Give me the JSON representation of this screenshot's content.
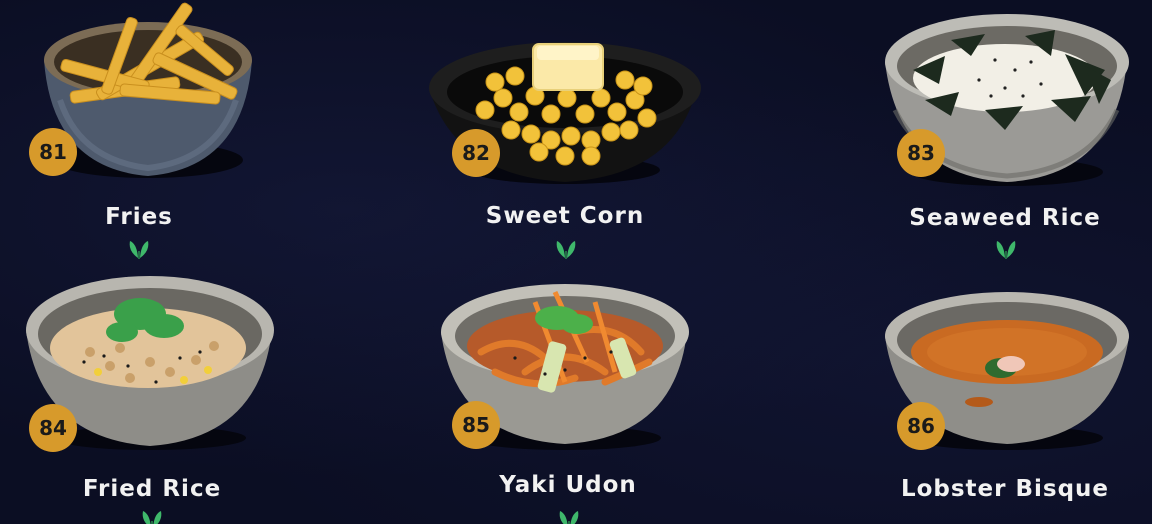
{
  "menu": {
    "items": [
      {
        "number": "81",
        "name": "Fries",
        "vegetarian_icon": "leaf-icon"
      },
      {
        "number": "82",
        "name": "Sweet Corn",
        "vegetarian_icon": "leaf-icon"
      },
      {
        "number": "83",
        "name": "Seaweed Rice",
        "vegetarian_icon": "leaf-icon"
      },
      {
        "number": "84",
        "name": "Fried Rice",
        "vegetarian_icon": "leaf-icon"
      },
      {
        "number": "85",
        "name": "Yaki Udon",
        "vegetarian_icon": "leaf-icon"
      },
      {
        "number": "86",
        "name": "Lobster Bisque",
        "vegetarian_icon": "leaf-icon"
      }
    ]
  },
  "colors": {
    "background": "#0b0e23",
    "badge": "#d79a2b",
    "leaf": "#3fb86b",
    "text": "#f2f2f2"
  }
}
